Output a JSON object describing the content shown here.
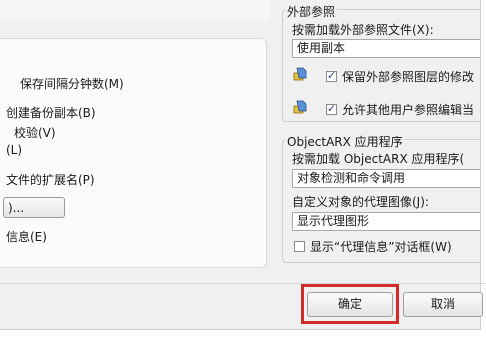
{
  "left": {
    "interval_label": "保存间隔分钟数(M)",
    "backup_label": "创建备份副本(B)",
    "check_label": "校验(V)",
    "log_label": "(L)",
    "ext_label": "文件的扩展名(P)",
    "button_label": ")...",
    "info_label": "信息(E)"
  },
  "xref": {
    "title": "外部参照",
    "load_label": "按需加载外部参照文件(X):",
    "load_value": "使用副本",
    "retain_label": "保留外部参照图层的修改",
    "allow_label": "允许其他用户参照编辑当"
  },
  "objectarx": {
    "title": "ObjectARX 应用程序",
    "load_label": "按需加载 ObjectARX 应用程序(",
    "load_value": "对象检测和命令调用",
    "proxy_label": "自定义对象的代理图像(J):",
    "proxy_value": "显示代理图形",
    "dialog_label": "显示“代理信息”对话框(W)"
  },
  "footer": {
    "ok_label": "确定",
    "cancel_label": "取消"
  },
  "colors": {
    "highlight": "#d42a2a"
  }
}
